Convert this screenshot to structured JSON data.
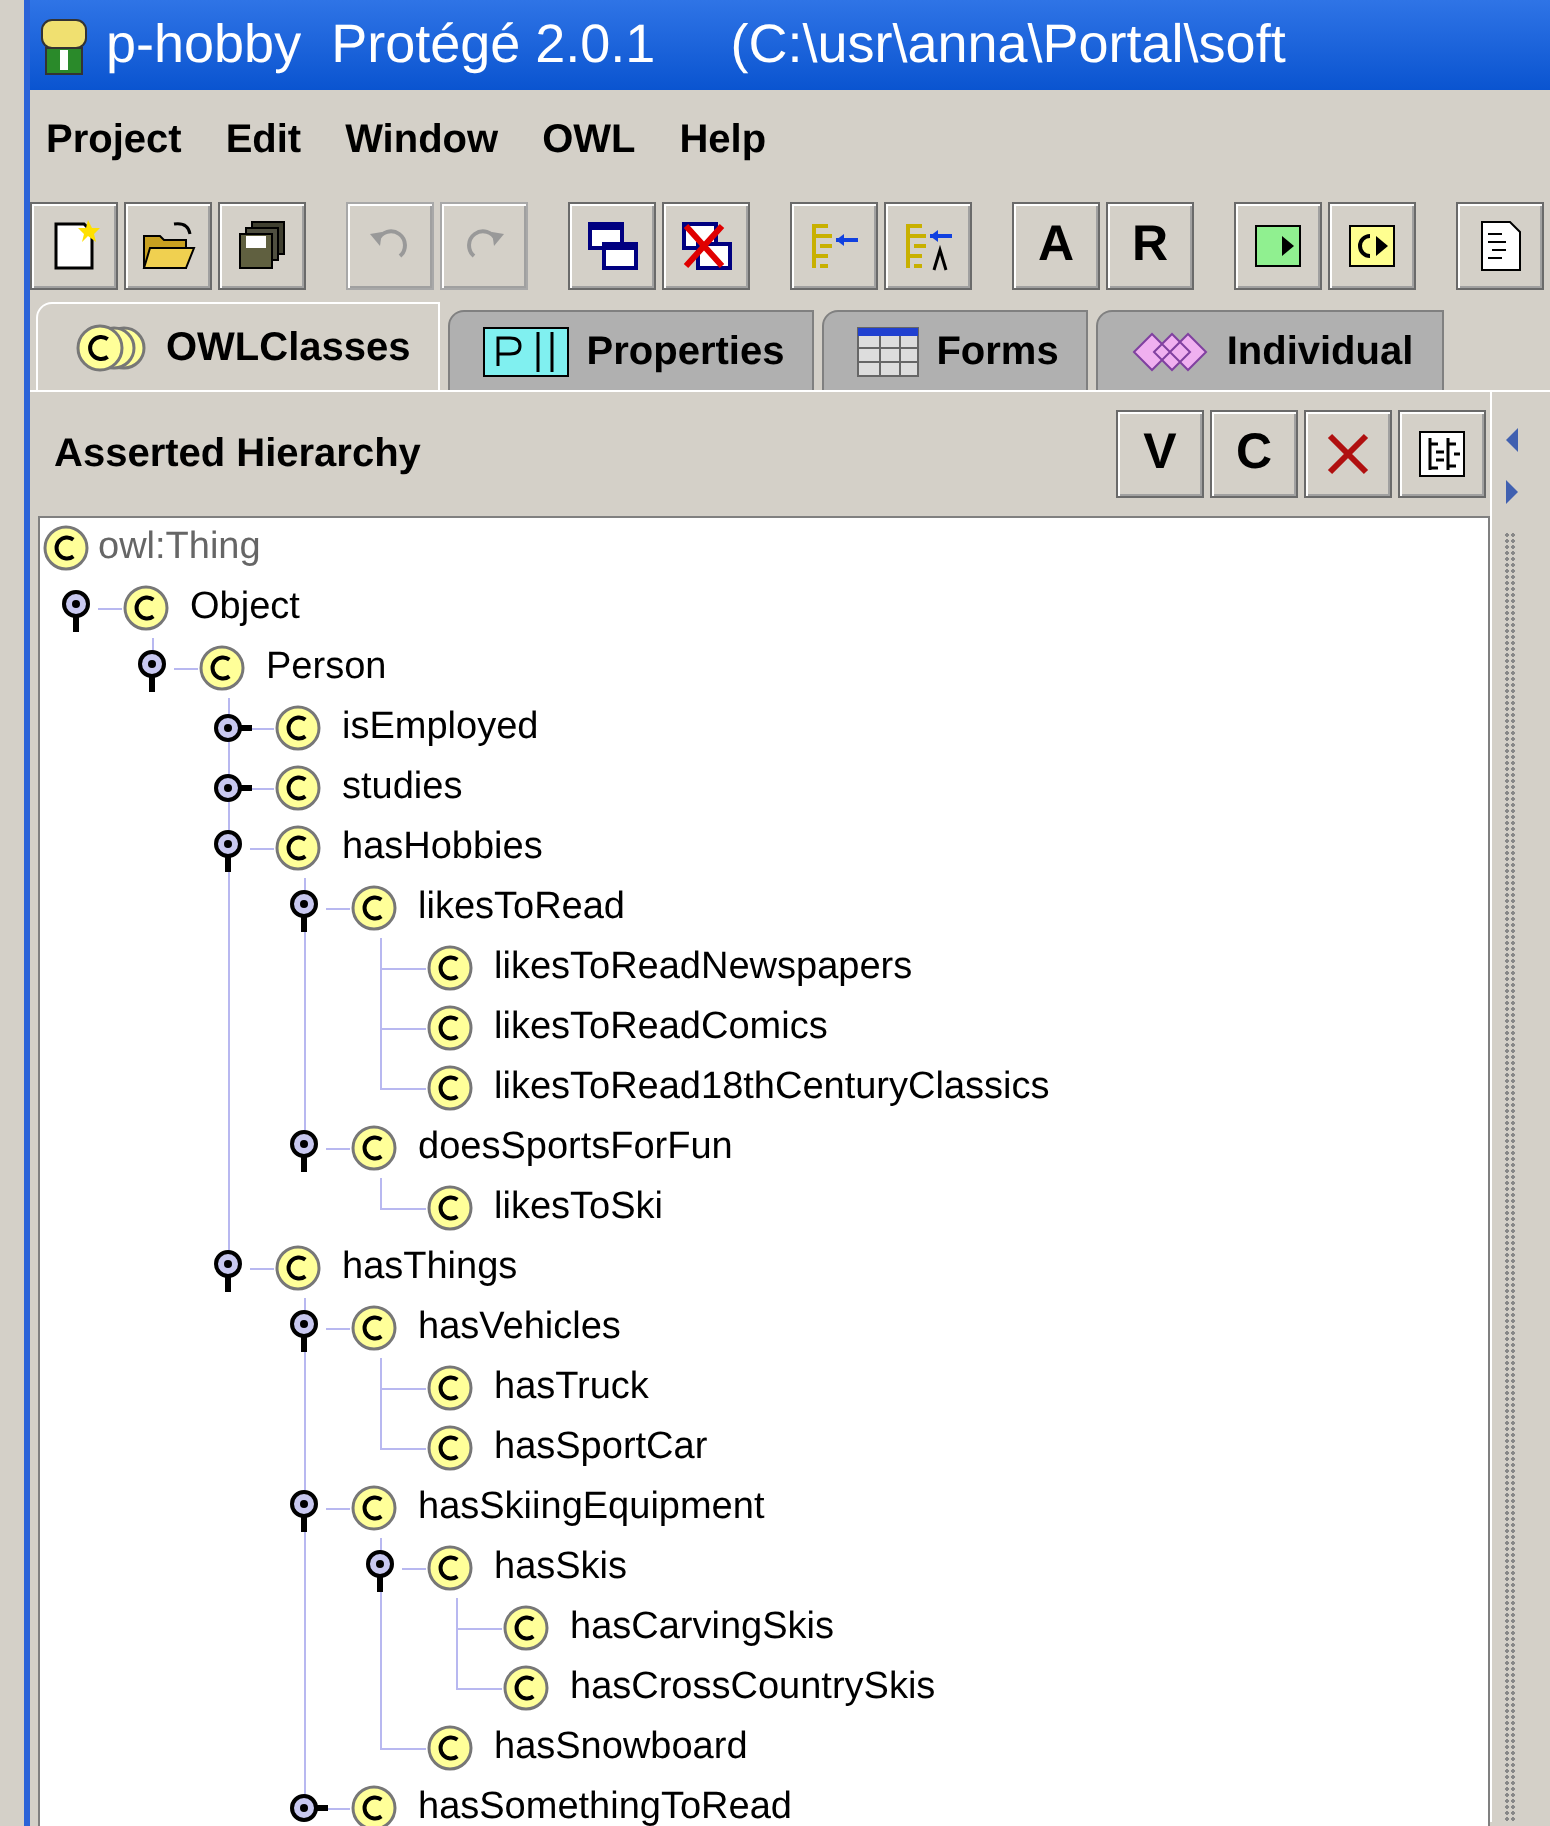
{
  "window": {
    "title": "p-hobby  Protégé 2.0.1     (C:\\usr\\anna\\Portal\\soft"
  },
  "menu": [
    "Project",
    "Edit",
    "Window",
    "OWL",
    "Help"
  ],
  "toolbar": [
    [
      {
        "kind": "icon",
        "disabled": false
      },
      {
        "kind": "icon",
        "disabled": false
      },
      {
        "kind": "icon",
        "disabled": false
      }
    ],
    [
      {
        "kind": "icon",
        "disabled": true
      },
      {
        "kind": "icon",
        "disabled": true
      }
    ],
    [
      {
        "kind": "icon",
        "disabled": false
      },
      {
        "kind": "icon",
        "disabled": false
      }
    ],
    [
      {
        "kind": "icon",
        "disabled": false
      },
      {
        "kind": "icon",
        "disabled": false
      }
    ],
    [
      {
        "kind": "text",
        "label": "A",
        "disabled": false
      },
      {
        "kind": "text",
        "label": "R",
        "disabled": false
      }
    ],
    [
      {
        "kind": "icon",
        "disabled": false
      },
      {
        "kind": "icon",
        "disabled": false
      }
    ],
    [
      {
        "kind": "icon",
        "disabled": false
      }
    ]
  ],
  "tabs": [
    {
      "label": "OWLClasses",
      "selected": true
    },
    {
      "label": "Properties",
      "selected": false
    },
    {
      "label": "Forms",
      "selected": false
    },
    {
      "label": "Individual",
      "selected": false
    }
  ],
  "hierarchy": {
    "title": "Asserted Hierarchy",
    "buttons": [
      {
        "kind": "text",
        "label": "V"
      },
      {
        "kind": "text",
        "label": "C"
      },
      {
        "kind": "icon"
      },
      {
        "kind": "icon"
      }
    ],
    "root": {
      "label": "owl:Thing"
    },
    "tree": [
      {
        "label": "Object",
        "expanded": true,
        "children": [
          {
            "label": "Person",
            "expanded": true,
            "children": [
              {
                "label": "isEmployed",
                "expanded": false
              },
              {
                "label": "studies",
                "expanded": false
              },
              {
                "label": "hasHobbies",
                "expanded": true,
                "children": [
                  {
                    "label": "likesToRead",
                    "expanded": true,
                    "children": [
                      {
                        "label": "likesToReadNewspapers"
                      },
                      {
                        "label": "likesToReadComics"
                      },
                      {
                        "label": "likesToRead18thCenturyClassics"
                      }
                    ]
                  },
                  {
                    "label": "doesSportsForFun",
                    "expanded": true,
                    "children": [
                      {
                        "label": "likesToSki"
                      }
                    ]
                  }
                ]
              },
              {
                "label": "hasThings",
                "expanded": true,
                "children": [
                  {
                    "label": "hasVehicles",
                    "expanded": true,
                    "children": [
                      {
                        "label": "hasTruck"
                      },
                      {
                        "label": "hasSportCar"
                      }
                    ]
                  },
                  {
                    "label": "hasSkiingEquipment",
                    "expanded": true,
                    "children": [
                      {
                        "label": "hasSkis",
                        "expanded": true,
                        "children": [
                          {
                            "label": "hasCarvingSkis"
                          },
                          {
                            "label": "hasCrossCountrySkis"
                          }
                        ]
                      },
                      {
                        "label": "hasSnowboard"
                      }
                    ]
                  },
                  {
                    "label": "hasSomethingToRead",
                    "expanded": false
                  }
                ]
              }
            ]
          }
        ]
      }
    ]
  }
}
